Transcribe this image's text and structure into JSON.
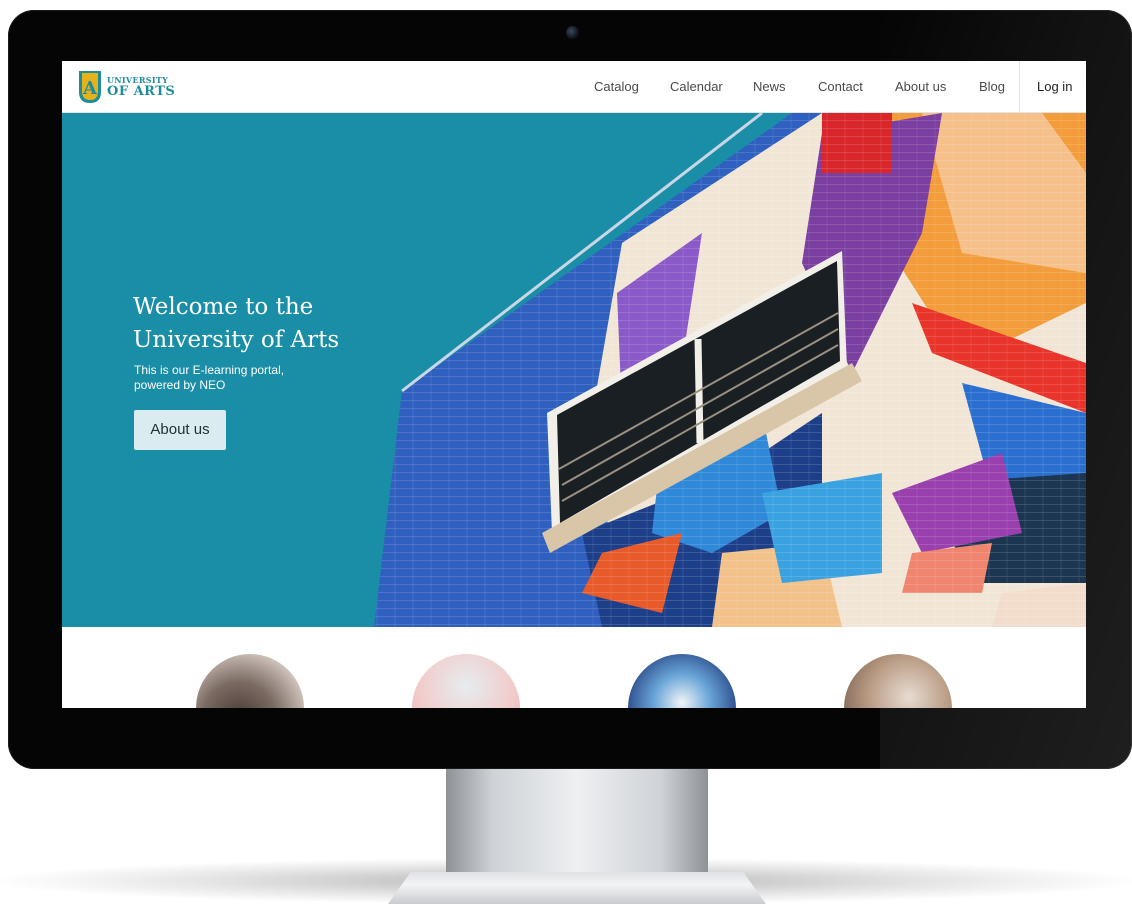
{
  "brand": {
    "line1": "UNIVERSITY",
    "line2": "OF ARTS",
    "mark_letter": "A",
    "colors": {
      "teal": "#1f8c9a",
      "gold": "#e3b21c"
    }
  },
  "nav": {
    "items": [
      {
        "label": "Catalog"
      },
      {
        "label": "Calendar"
      },
      {
        "label": "News"
      },
      {
        "label": "Contact"
      },
      {
        "label": "About us"
      },
      {
        "label": "Blog"
      }
    ],
    "login_label": "Log in"
  },
  "hero": {
    "title": "Welcome to the\nUniversity of Arts",
    "subtitle": "This is our E-learning portal,\npowered by NEO",
    "button_label": "About us",
    "colors": {
      "sky": "#1b8ea7",
      "button_bg": "#dbecf0"
    }
  },
  "features": {
    "circles": [
      {
        "icon": "people-photo-icon"
      },
      {
        "icon": "lightbulb-photo-icon"
      },
      {
        "icon": "painting-photo-icon"
      },
      {
        "icon": "writing-photo-icon"
      }
    ]
  }
}
